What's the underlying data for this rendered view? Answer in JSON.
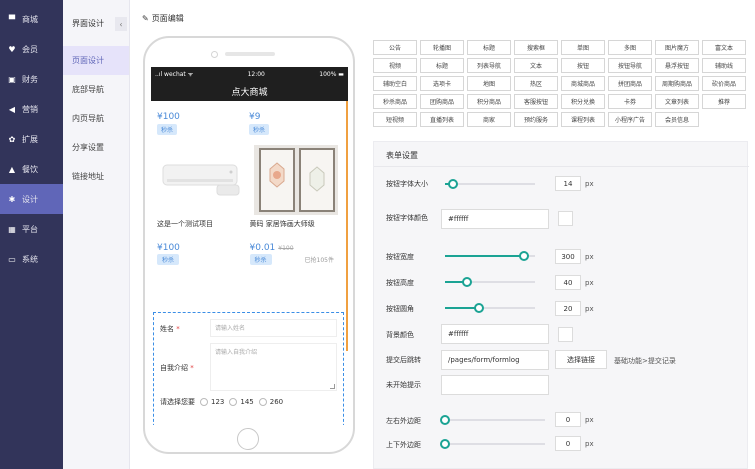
{
  "sidebar": {
    "items": [
      {
        "icon": "home-icon",
        "glyph": "▀",
        "label": "商城",
        "active": false
      },
      {
        "icon": "heart-icon",
        "glyph": "♥",
        "label": "会员",
        "active": false
      },
      {
        "icon": "finance-icon",
        "glyph": "▣",
        "label": "财务",
        "active": false
      },
      {
        "icon": "megaphone-icon",
        "glyph": "◀",
        "label": "营销",
        "active": false
      },
      {
        "icon": "extension-icon",
        "glyph": "✿",
        "label": "扩展",
        "active": false
      },
      {
        "icon": "mountain-icon",
        "glyph": "▲",
        "label": "餐饮",
        "active": false
      },
      {
        "icon": "design-icon",
        "glyph": "✱",
        "label": "设计",
        "active": true
      },
      {
        "icon": "grid-icon",
        "glyph": "▦",
        "label": "平台",
        "active": false
      },
      {
        "icon": "monitor-icon",
        "glyph": "▭",
        "label": "系统",
        "active": false
      }
    ]
  },
  "subnav": {
    "title": "界面设计",
    "collapse_glyph": "‹",
    "items": [
      {
        "label": "页面设计",
        "active": true
      },
      {
        "label": "底部导航",
        "active": false
      },
      {
        "label": "内页导航",
        "active": false
      },
      {
        "label": "分享设置",
        "active": false
      },
      {
        "label": "链接地址",
        "active": false
      }
    ]
  },
  "main": {
    "title": "页面编辑",
    "title_icon": "edit-icon"
  },
  "phone": {
    "status_left": "..ıl wechat ᯤ",
    "status_time": "12:00",
    "status_right": "100% ▬",
    "page_title": "点大商城",
    "coupons": [
      {
        "amount": "¥100",
        "button": "秒杀"
      },
      {
        "amount": "¥9",
        "button": "秒杀"
      }
    ],
    "goods": [
      {
        "name": "这是一个测试项目",
        "price": "¥100",
        "old_price": "",
        "button": "秒杀",
        "sold": ""
      },
      {
        "name": "黄码 家居饰画大师级",
        "price": "¥0.01",
        "old_price": "¥100",
        "button": "秒杀",
        "sold": "已抢105件"
      }
    ],
    "form": {
      "name_label": "姓名",
      "name_placeholder": "请输入姓名",
      "intro_label": "自我介绍",
      "intro_placeholder": "请输入自我介绍",
      "choose_label": "请选择您要",
      "required_mark": "*",
      "options": [
        "123",
        "145",
        "260"
      ]
    }
  },
  "palette": {
    "rows": [
      [
        "公告",
        "轮播图",
        "标题",
        "搜索框",
        "单图",
        "多图",
        "图片魔方",
        "富文本"
      ],
      [
        "视频",
        "标题",
        "列表导航",
        "文本",
        "按钮",
        "按钮导航",
        "悬浮按钮",
        "辅助线"
      ],
      [
        "辅助空白",
        "选项卡",
        "地图",
        "热区",
        "商城商品",
        "拼团商品",
        "周期购商品",
        "砍价商品"
      ],
      [
        "秒杀商品",
        "团购商品",
        "积分商品",
        "客服按钮",
        "积分兑换",
        "卡券",
        "文章列表",
        "推荐"
      ],
      [
        "短视频",
        "直播列表",
        "商家",
        "预约服务",
        "课程列表",
        "小程序广告",
        "会员信息"
      ]
    ]
  },
  "settings": {
    "title": "表单设置",
    "font_size": {
      "label": "按钮字体大小",
      "value": "14",
      "unit": "px",
      "fraction": 0.09
    },
    "font_color": {
      "label": "按钮字体颜色",
      "value": "#ffffff"
    },
    "btn_width": {
      "label": "按钮宽度",
      "value": "300",
      "unit": "px",
      "fraction": 0.88
    },
    "btn_height": {
      "label": "按钮高度",
      "value": "40",
      "unit": "px",
      "fraction": 0.24
    },
    "btn_radius": {
      "label": "按钮圆角",
      "value": "20",
      "unit": "px",
      "fraction": 0.38
    },
    "bg_color": {
      "label": "背景颜色",
      "value": "#ffffff"
    },
    "redirect": {
      "label": "提交后跳转",
      "value": "/pages/form/formlog",
      "button": "选择链接",
      "info": "基础功能>提交记录"
    },
    "not_started": {
      "label": "未开始提示",
      "value": ""
    },
    "lr_margin": {
      "label": "左右外边距",
      "value": "0",
      "unit": "px",
      "fraction": 0.0
    },
    "tb_margin": {
      "label": "上下外边距",
      "value": "0",
      "unit": "px",
      "fraction": 0.0
    }
  }
}
